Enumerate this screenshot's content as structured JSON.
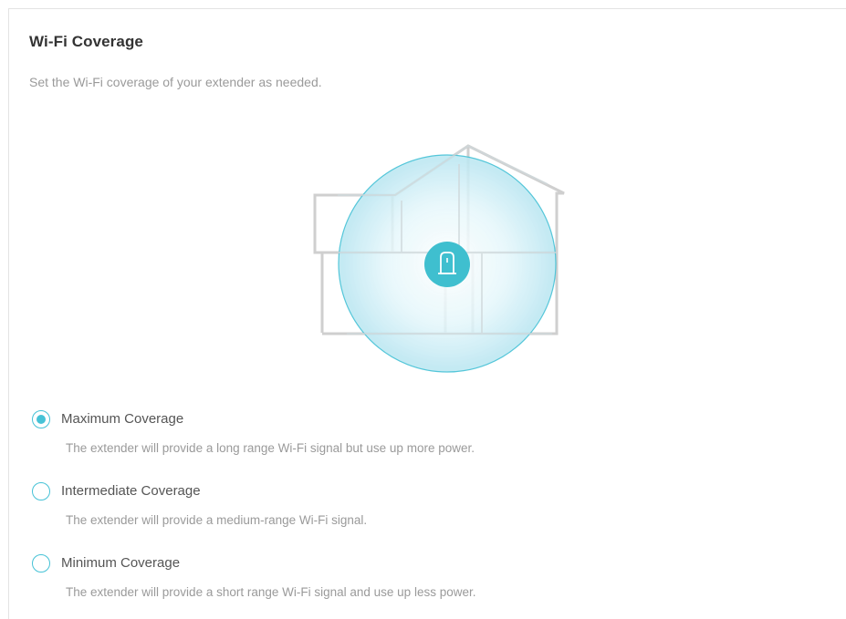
{
  "section": {
    "title": "Wi-Fi Coverage",
    "subtitle": "Set the Wi-Fi coverage of your extender as needed."
  },
  "illustration": {
    "icons": [
      "house-outline",
      "coverage-circle",
      "extender-icon"
    ],
    "colors": {
      "house_outline": "#cfcfcf",
      "coverage_fill": "#bfe9f3",
      "coverage_edge": "#46c2d6",
      "extender_badge": "#3fbfcf"
    }
  },
  "options": [
    {
      "label": "Maximum Coverage",
      "description": "The extender will provide a long range Wi-Fi signal but use up more power.",
      "selected": true
    },
    {
      "label": "Intermediate Coverage",
      "description": "The extender will provide a medium-range Wi-Fi signal.",
      "selected": false
    },
    {
      "label": "Minimum Coverage",
      "description": "The extender will provide a short range Wi-Fi signal and use up less power.",
      "selected": false
    }
  ],
  "accent_color": "#46c2d6"
}
